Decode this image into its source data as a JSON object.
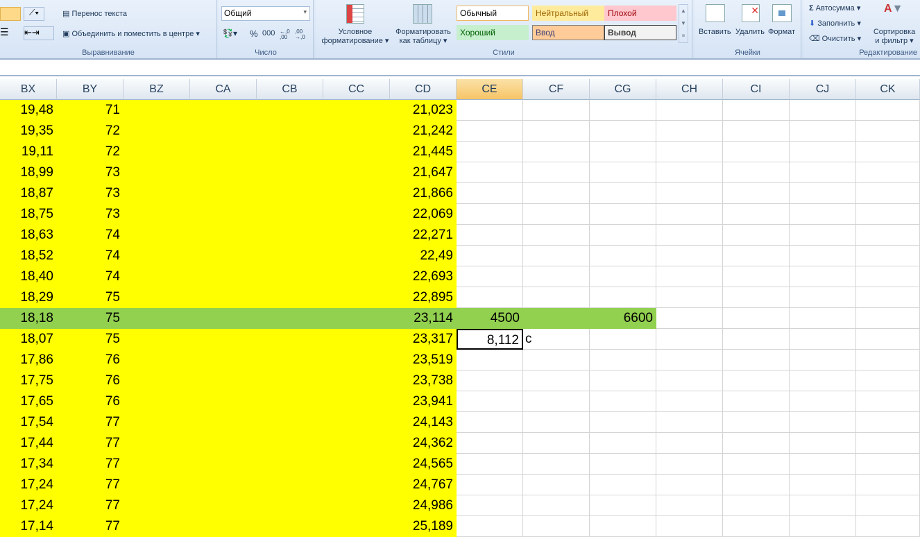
{
  "ribbon": {
    "alignment": {
      "wrap_text": "Перенос текста",
      "merge_center": "Объединить и поместить в центре",
      "label": "Выравнивание"
    },
    "number": {
      "format": "Общий",
      "percent": "%",
      "thousands": "000",
      "inc_decimal": "←,0 ,00",
      "dec_decimal": ",00 →,0",
      "label": "Число"
    },
    "styles": {
      "conditional_1": "Условное",
      "conditional_2": "форматирование",
      "format_table_1": "Форматировать",
      "format_table_2": "как таблицу",
      "normal": "Обычный",
      "neutral": "Нейтральный",
      "bad": "Плохой",
      "good": "Хороший",
      "input": "Ввод",
      "output": "Вывод",
      "label": "Стили"
    },
    "cells": {
      "insert": "Вставить",
      "delete": "Удалить",
      "format": "Формат",
      "label": "Ячейки"
    },
    "editing": {
      "autosum": "Автосумма",
      "fill": "Заполнить",
      "clear": "Очистить",
      "sort_1": "Сортировка",
      "sort_2": "и фильтр",
      "label": "Редактирование"
    }
  },
  "columns": [
    "BX",
    "BY",
    "BZ",
    "CA",
    "CB",
    "CC",
    "CD",
    "CE",
    "CF",
    "CG",
    "CH",
    "CI",
    "CJ",
    "CK"
  ],
  "selected_column": "CE",
  "rows": [
    {
      "bx": "19,48",
      "by": "71",
      "cd": "21,023"
    },
    {
      "bx": "19,35",
      "by": "72",
      "cd": "21,242"
    },
    {
      "bx": "19,11",
      "by": "72",
      "cd": "21,445"
    },
    {
      "bx": "18,99",
      "by": "73",
      "cd": "21,647"
    },
    {
      "bx": "18,87",
      "by": "73",
      "cd": "21,866"
    },
    {
      "bx": "18,75",
      "by": "73",
      "cd": "22,069"
    },
    {
      "bx": "18,63",
      "by": "74",
      "cd": "22,271"
    },
    {
      "bx": "18,52",
      "by": "74",
      "cd": "22,49"
    },
    {
      "bx": "18,40",
      "by": "74",
      "cd": "22,693"
    },
    {
      "bx": "18,29",
      "by": "75",
      "cd": "22,895"
    },
    {
      "bx": "18,18",
      "by": "75",
      "cd": "23,114",
      "ce": "4500",
      "cg": "6600",
      "highlight": true
    },
    {
      "bx": "18,07",
      "by": "75",
      "cd": "23,317",
      "ce": "8,112",
      "cf": "с",
      "active": true
    },
    {
      "bx": "17,86",
      "by": "76",
      "cd": "23,519"
    },
    {
      "bx": "17,75",
      "by": "76",
      "cd": "23,738"
    },
    {
      "bx": "17,65",
      "by": "76",
      "cd": "23,941"
    },
    {
      "bx": "17,54",
      "by": "77",
      "cd": "24,143"
    },
    {
      "bx": "17,44",
      "by": "77",
      "cd": "24,362"
    },
    {
      "bx": "17,34",
      "by": "77",
      "cd": "24,565"
    },
    {
      "bx": "17,24",
      "by": "77",
      "cd": "24,767"
    },
    {
      "bx": "17,24",
      "by": "77",
      "cd": "24,986"
    },
    {
      "bx": "17,14",
      "by": "77",
      "cd": "25,189"
    }
  ],
  "colors": {
    "yellow": "#ffff00",
    "green": "#92d050"
  }
}
